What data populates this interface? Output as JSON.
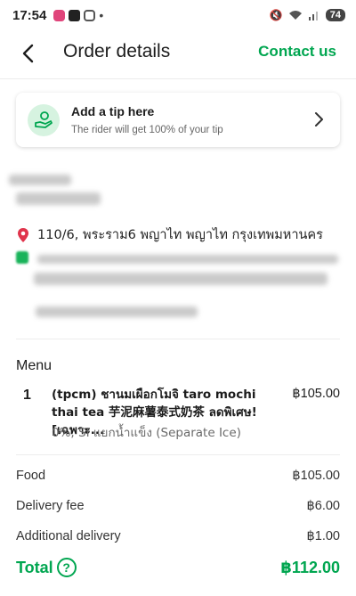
{
  "status_bar": {
    "time": "17:54",
    "battery": "74",
    "accent_colors": [
      "#e0457b",
      "#222222",
      "#c13584"
    ]
  },
  "header": {
    "title": "Order details",
    "contact_label": "Contact us"
  },
  "tip": {
    "title": "Add a tip here",
    "subtitle": "The rider will get 100% of your tip"
  },
  "address": {
    "line": "110/6, พระราม6 พญาไท พญาไท กรุงเทพมหานคร"
  },
  "menu": {
    "heading": "Menu",
    "items": [
      {
        "qty": "1",
        "name": "(tpcm) ชานมเผือกโมจิ taro mochi thai tea 芋泥麻薯泰式奶茶 ลดพิเศษ! [เฉพาะ...",
        "options": "0%, SI แยกน้ำแข็ง (Separate Ice)",
        "price": "฿105.00"
      }
    ]
  },
  "fees": {
    "food_label": "Food",
    "food_value": "฿105.00",
    "delivery_label": "Delivery fee",
    "delivery_value": "฿6.00",
    "additional_label": "Additional delivery",
    "additional_value": "฿1.00"
  },
  "total": {
    "label": "Total",
    "value": "฿112.00"
  },
  "colors": {
    "brand_green": "#00a650",
    "pin_red": "#e0344b"
  }
}
